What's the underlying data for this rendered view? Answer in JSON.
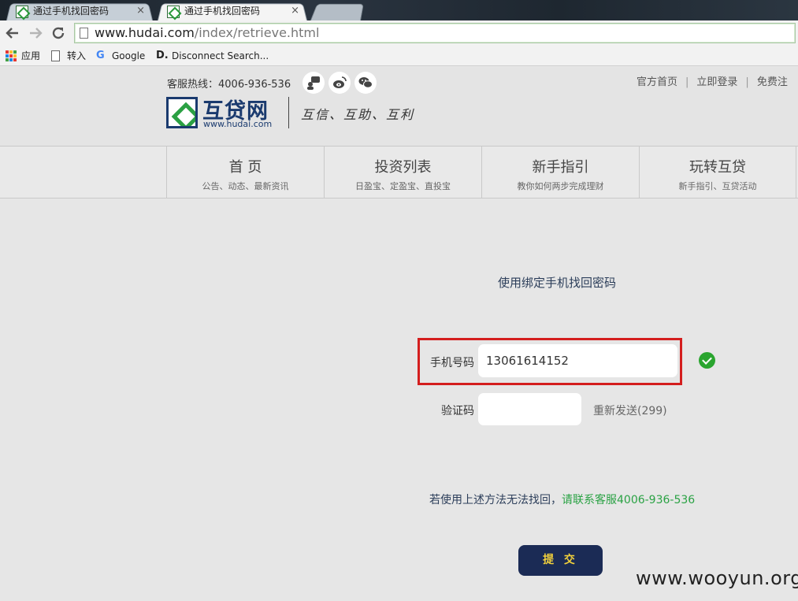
{
  "browser": {
    "tabs": [
      {
        "title": "通过手机找回密码",
        "close": "×"
      },
      {
        "title": "通过手机找回密码",
        "close": "×"
      }
    ],
    "url_domain": "www.hudai.com",
    "url_path": "/index/retrieve.html",
    "bookmarks": [
      "应用",
      "转入",
      "Google",
      "Disconnect Search..."
    ]
  },
  "header": {
    "hotline": "客服热线：4006-936-536",
    "top_links": [
      "官方首页",
      "立即登录",
      "免费注"
    ],
    "logo_cn": "互贷网",
    "logo_url": "www.hudai.com",
    "slogan": "互信、互助、互利"
  },
  "nav": [
    {
      "title": "首 页",
      "sub": "公告、动态、最新资讯"
    },
    {
      "title": "投资列表",
      "sub": "日盈宝、定盈宝、直投宝"
    },
    {
      "title": "新手指引",
      "sub": "教你如何两步完成理财"
    },
    {
      "title": "玩转互贷",
      "sub": "新手指引、互贷活动"
    }
  ],
  "form": {
    "heading": "使用绑定手机找回密码",
    "phone_label": "手机号码",
    "phone_value": "13061614152",
    "code_label": "验证码",
    "code_value": "",
    "resend": "重新发送(299)",
    "help_prefix": "若使用上述方法无法找回，",
    "help_contact": "请联系客服4006-936-536",
    "submit": "提 交"
  },
  "watermark": "www.wooyun.org",
  "icons": {
    "phone_valid": "check-circle-icon",
    "social": [
      "chat-icon",
      "weibo-icon",
      "wechat-icon"
    ]
  },
  "colors": {
    "brand_navy": "#1b2b55",
    "brand_green": "#2aa244",
    "highlight_red": "#d41e1e",
    "button_text": "#f4d23b"
  }
}
